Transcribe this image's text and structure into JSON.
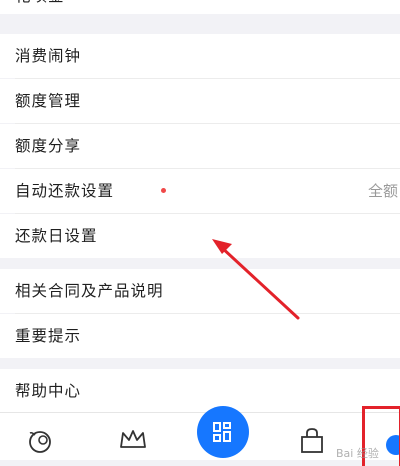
{
  "menu": {
    "top_item": "花呗金",
    "items": [
      {
        "label": "消费闹钟"
      },
      {
        "label": "额度管理"
      },
      {
        "label": "额度分享"
      },
      {
        "label": "自动还款设置",
        "value": "全额"
      },
      {
        "label": "还款日设置"
      },
      {
        "label": "相关合同及产品说明"
      },
      {
        "label": "重要提示"
      },
      {
        "label": "帮助中心"
      }
    ]
  },
  "tabbar": {
    "icons": [
      "mascot-icon",
      "crown-icon",
      "scan-icon",
      "bag-icon",
      "profile-icon"
    ],
    "accent": "#1677ff"
  },
  "annotation": {
    "arrow_color": "#e3222a",
    "highlight_color": "#e3222a",
    "watermark": "Bai 经验"
  },
  "colors": {
    "background": "#f2f2f6",
    "row": "#ffffff",
    "badge_dot": "#f04848"
  }
}
